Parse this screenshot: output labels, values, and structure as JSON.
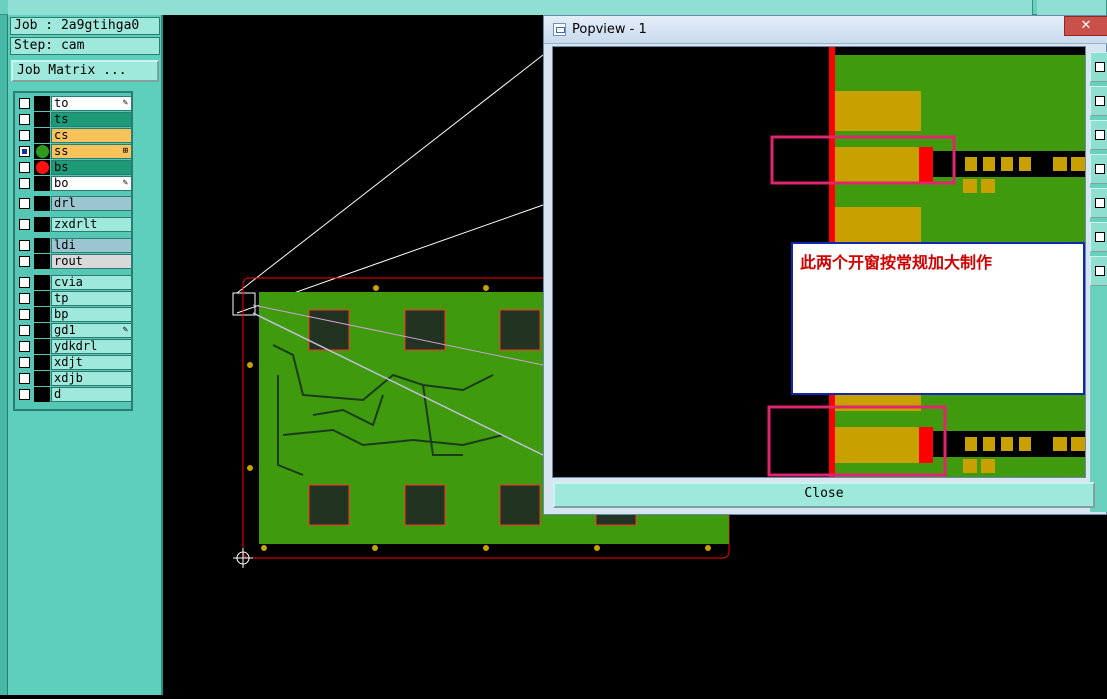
{
  "left_panel": {
    "job_line": "Job : 2a9gtihga0",
    "step_line": "Step: cam",
    "job_matrix_button": "Job Matrix ..."
  },
  "layers": [
    {
      "name": "to",
      "bg": "#ffffff",
      "flag": "✎",
      "mark": "",
      "checked": false
    },
    {
      "name": "ts",
      "bg": "#1f9a78",
      "flag": "",
      "mark": "",
      "checked": false
    },
    {
      "name": "cs",
      "bg": "#f7c35a",
      "flag": "",
      "mark": "",
      "checked": false
    },
    {
      "name": "ss",
      "bg": "#f7c35a",
      "flag": "⊞",
      "mark": "#2e9b1e",
      "checked": true
    },
    {
      "name": "bs",
      "bg": "#1f9a78",
      "flag": "",
      "mark": "#ff1010",
      "checked": false
    },
    {
      "name": "bo",
      "bg": "#ffffff",
      "flag": "✎",
      "mark": "",
      "checked": false
    },
    {
      "name": "drl",
      "bg": "#9cc6cf",
      "flag": "",
      "mark": "",
      "checked": false
    },
    {
      "name": "zxdrlt",
      "bg": "#9fe8dc",
      "flag": "",
      "mark": "",
      "checked": false
    },
    {
      "name": "ldi",
      "bg": "#9cc6cf",
      "flag": "",
      "mark": "",
      "checked": false
    },
    {
      "name": "rout",
      "bg": "#d9d9d9",
      "flag": "",
      "mark": "",
      "checked": false
    },
    {
      "name": "cvia",
      "bg": "#9fe8dc",
      "flag": "",
      "mark": "",
      "checked": false
    },
    {
      "name": "tp",
      "bg": "#9fe8dc",
      "flag": "",
      "mark": "",
      "checked": false
    },
    {
      "name": "bp",
      "bg": "#9fe8dc",
      "flag": "",
      "mark": "",
      "checked": false
    },
    {
      "name": "gd1",
      "bg": "#9fe8dc",
      "flag": "✎",
      "mark": "",
      "checked": false
    },
    {
      "name": "ydkdrl",
      "bg": "#9fe8dc",
      "flag": "",
      "mark": "",
      "checked": false
    },
    {
      "name": "xdjt",
      "bg": "#9fe8dc",
      "flag": "",
      "mark": "",
      "checked": false
    },
    {
      "name": "xdjb",
      "bg": "#9fe8dc",
      "flag": "",
      "mark": "",
      "checked": false
    },
    {
      "name": "d",
      "bg": "#9fe8dc",
      "flag": "",
      "mark": "",
      "checked": false
    }
  ],
  "popview": {
    "title": "Popview - 1",
    "close_x": "✕",
    "close_button": "Close",
    "annotation": "此两个开窗按常规加大制作"
  },
  "colors": {
    "board_green": "#3f9a0e",
    "pad_gold": "#c8a000",
    "outline_red": "#ff0000",
    "highlight_magenta": "#e0246e"
  }
}
